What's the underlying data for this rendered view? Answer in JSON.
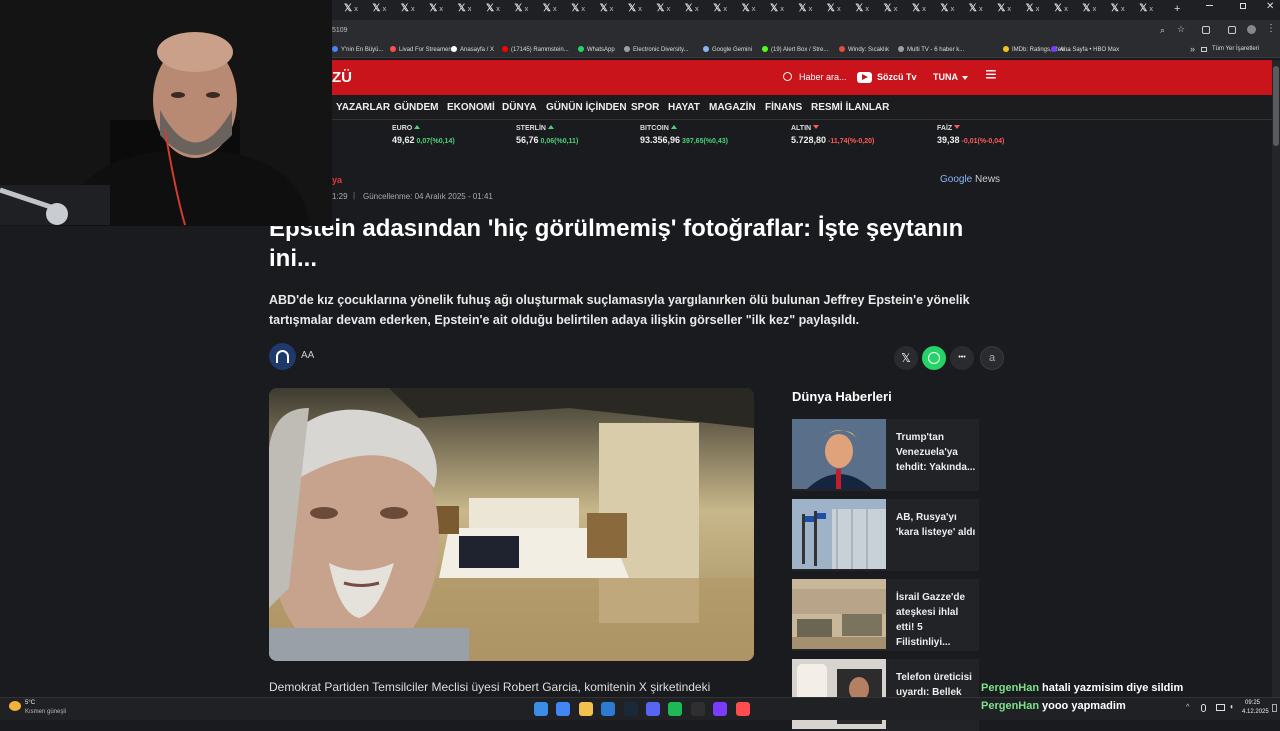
{
  "browser": {
    "tab_glyph": "𝕏",
    "tab_close": "x",
    "new_tab": "+",
    "url_fragment": "5109",
    "bookmarks": [
      {
        "label": "Y'nin En Büyü...",
        "color": "#4285f4"
      },
      {
        "label": "Livad For Streamers",
        "color": "#ff4c4c"
      },
      {
        "label": "Anasayfa / X",
        "color": "#ffffff"
      },
      {
        "label": "(17145) Rammstein...",
        "color": "#ff0000"
      },
      {
        "label": "WhatsApp",
        "color": "#25d366"
      },
      {
        "label": "Electronic Diversity...",
        "color": "#9aa0a6"
      },
      {
        "label": "Google Gemini",
        "color": "#8ab4f8"
      },
      {
        "label": "(19) Alert Box / Stre...",
        "color": "#53fc18"
      },
      {
        "label": "Windy: Sıcaklık",
        "color": "#e94b3c"
      },
      {
        "label": "Multi TV - 6 haber k...",
        "color": "#9aa0a6"
      },
      {
        "label": "IMDb: Ratings, Revi...",
        "color": "#f5c518"
      },
      {
        "label": "Ana Sayfa • HBO Max",
        "color": "#7a3cff"
      }
    ],
    "bookmarks_more": "»",
    "all_bookmarks": "Tüm Yer İşaretleri"
  },
  "site": {
    "logo": "ZÜ",
    "search_placeholder": "Haber ara...",
    "tv_label": "Sözcü Tv",
    "tuna_label": "TUNA",
    "menu_icon": "≡",
    "nav": [
      "YAZARLAR",
      "GÜNDEM",
      "EKONOMİ",
      "DÜNYA",
      "GÜNÜN İÇİNDEN",
      "SPOR",
      "HAYAT",
      "MAGAZİN",
      "FİNANS",
      "RESMİ İLANLAR"
    ],
    "ticker": [
      {
        "name": "EURO",
        "value": "49,62",
        "change": "0,07(%0,14)",
        "dir": "up"
      },
      {
        "name": "STERLİN",
        "value": "56,76",
        "change": "0,06(%0,11)",
        "dir": "up"
      },
      {
        "name": "BITCOIN",
        "value": "93.356,96",
        "change": "397,65(%0,43)",
        "dir": "up"
      },
      {
        "name": "ALTIN",
        "value": "5.728,80",
        "change": "-11,74(%-0,20)",
        "dir": "down"
      },
      {
        "name": "FAİZ",
        "value": "39,38",
        "change": "-0,01(%-0,04)",
        "dir": "down"
      }
    ]
  },
  "article": {
    "category": "ya",
    "time": "1:29",
    "updated": "Güncellenme: 04 Aralık 2025 - 01:41",
    "google_news_google": "Google",
    "google_news_news": "News",
    "headline": "Epstein adasından 'hiç görülmemiş' fotoğraflar: İşte şeytanın ini...",
    "lead": "ABD'de kız çocuklarına yönelik fuhuş ağı oluşturmak suçlamasıyla yargılanırken ölü bulunan Jeffrey Epstein'e yönelik tartışmalar devam ederken, Epstein'e ait olduğu belirtilen adaya ilişkin görseller \"ilk kez\" paylaşıldı.",
    "source": "AA",
    "share_x": "𝕏",
    "share_more": "•••",
    "share_font": "a",
    "body_start": "Demokrat Partiden Temsilciler Meclisi üyesi Robert Garcia, komitenin X şirketindeki"
  },
  "sidebar": {
    "title": "Dünya Haberleri",
    "items": [
      {
        "title": "Trump'tan Venezuela'ya tehdit: Yakında..."
      },
      {
        "title": "AB, Rusya'yı 'kara listeye' aldı"
      },
      {
        "title": "İsrail Gazze'de ateşkesi ihlal etti! 5 Filistinliyi..."
      },
      {
        "title": "Telefon üreticisi uyardı: Bellek krizi"
      }
    ]
  },
  "chat": [
    {
      "user": "PergenHan",
      "message": "hatali yazmisim diye sildim"
    },
    {
      "user": "PergenHan",
      "message": "yooo yapmadim"
    }
  ],
  "taskbar": {
    "weather_temp": "5°C",
    "weather_desc": "Kısmen güneşli",
    "time": "09:25",
    "date": "4.12.2025"
  },
  "colors": {
    "brand_red": "#c8141a",
    "chat_user": "#7ee08a"
  }
}
